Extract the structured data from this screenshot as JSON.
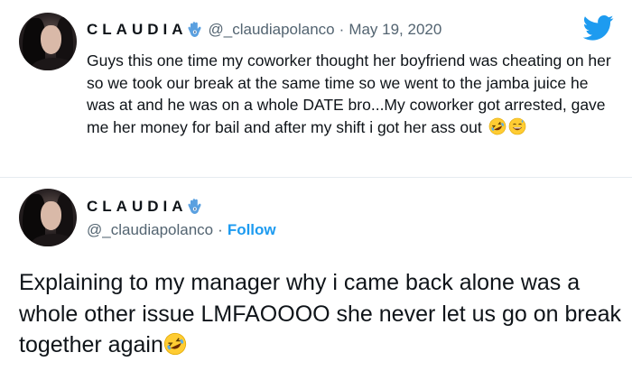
{
  "tweet": {
    "author_name": "CLAUDIA",
    "handle": "@_claudiapolanco",
    "separator": "·",
    "date": "May 19, 2020",
    "text": "Guys this one time my coworker thought her boyfriend was cheating on her so we took our break at the same time so we went to the jamba juice he was at and he was on a whole DATE bro...My coworker got arrested, gave me her money for bail and after my shift i got her ass out"
  },
  "reply": {
    "author_name": "CLAUDIA",
    "handle": "@_claudiapolanco",
    "separator": "·",
    "follow_label": "Follow",
    "text": "Explaining to my manager why i came back alone was a whole other issue LMFAOOOO she never let us go on break together again"
  },
  "icons": {
    "brand": "twitter-bird-icon",
    "name_emoji": "hamsa-hand-emoji",
    "tweet_emojis": [
      "rolling-on-floor-laughing-emoji",
      "grinning-sweat-emoji"
    ],
    "reply_emojis": [
      "rolling-on-floor-laughing-emoji"
    ]
  },
  "colors": {
    "text": "#0f1419",
    "secondary": "#536471",
    "accent": "#1d9bf0",
    "divider": "#e6ecf0"
  }
}
